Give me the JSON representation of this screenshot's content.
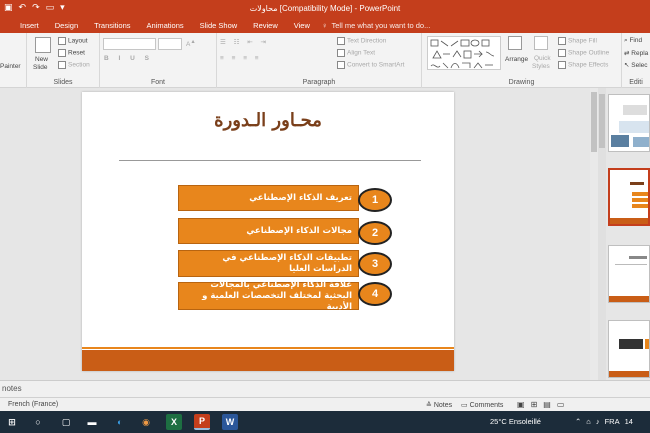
{
  "window": {
    "title": "محاولات [Compatibility Mode] - PowerPoint"
  },
  "quick_access": {
    "icons": [
      "save-icon",
      "undo-icon",
      "redo-icon",
      "present-icon",
      "customize-icon"
    ]
  },
  "tabs": [
    {
      "label": "Insert"
    },
    {
      "label": "Design"
    },
    {
      "label": "Transitions"
    },
    {
      "label": "Animations"
    },
    {
      "label": "Slide Show"
    },
    {
      "label": "Review"
    },
    {
      "label": "View"
    }
  ],
  "tell_me": {
    "placeholder": "Tell me what you want to do..."
  },
  "ribbon": {
    "clipboard": {
      "painter": "Painter"
    },
    "slides": {
      "new_slide": "New",
      "new_slide2": "Slide",
      "layout": "Layout",
      "reset": "Reset",
      "section": "Section",
      "group_name": "Slides"
    },
    "font": {
      "group_name": "Font"
    },
    "paragraph": {
      "text_direction": "Text Direction",
      "align_text": "Align Text",
      "convert_smartart": "Convert to SmartArt",
      "group_name": "Paragraph"
    },
    "drawing": {
      "arrange": "Arrange",
      "quick_styles": "Quick",
      "quick_styles2": "Styles",
      "shape_fill": "Shape Fill",
      "shape_outline": "Shape Outline",
      "shape_effects": "Shape Effects",
      "group_name": "Drawing"
    },
    "editing": {
      "find": "Find",
      "replace": "Repla",
      "select": "Selec",
      "group_name": "Editi"
    }
  },
  "slide": {
    "title": "محـاور الـدورة",
    "items": [
      {
        "number": "1",
        "text": "تعريف الذكاء الإصطناعي"
      },
      {
        "number": "2",
        "text": "مجالات الذكاء الإصطناعي"
      },
      {
        "number": "3",
        "text": "تطبيقات الذكاء الإصطناعي في الدراسات العليا"
      },
      {
        "number": "4",
        "text": "علاقة الذكاء الإصطناعي بالمجالات البحثية لمختلف التخصصات العلمية و الأدبية"
      }
    ],
    "colors": {
      "accent": "#e8861c",
      "footer": "#c95d16",
      "title": "#7a3f1a"
    }
  },
  "notes": {
    "label": "notes"
  },
  "status": {
    "language": "French (France)",
    "notes_button": "Notes",
    "comments_button": "Comments"
  },
  "taskbar": {
    "weather": "25°C  Ensoleillé",
    "lang": "FRA",
    "time": "14",
    "apps": [
      "start-icon",
      "search-icon",
      "task-view-icon",
      "edge-icon",
      "chrome-icon",
      "excel-icon",
      "powerpoint-icon",
      "word-icon"
    ]
  }
}
